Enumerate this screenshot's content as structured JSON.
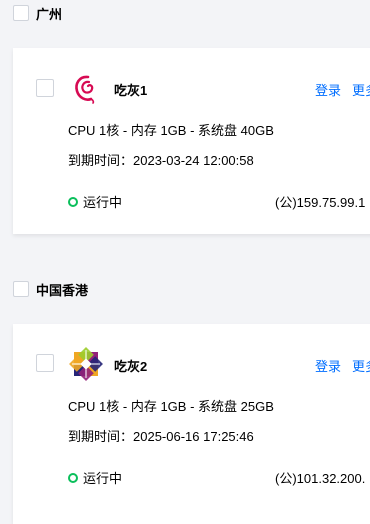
{
  "regions": [
    {
      "title": "广州",
      "instance": {
        "name": "吃灰1",
        "os_icon": "debian-icon",
        "login_label": "登录",
        "more_label": "更多",
        "spec": "CPU 1核 - 内存 1GB - 系统盘 40GB",
        "expire_label": "到期时间：",
        "expire_value": "2023-03-24 12:00:58",
        "status": "运行中",
        "ip": "(公)159.75.99.1"
      }
    },
    {
      "title": "中国香港",
      "instance": {
        "name": "吃灰2",
        "os_icon": "centos-icon",
        "login_label": "登录",
        "more_label": "更多",
        "spec": "CPU 1核 - 内存 1GB - 系统盘 25GB",
        "expire_label": "到期时间：",
        "expire_value": "2025-06-16 17:25:46",
        "status": "运行中",
        "ip": "(公)101.32.200."
      }
    }
  ],
  "colors": {
    "link": "#006eff",
    "status_running": "#0abf5b",
    "background": "#f3f4f7",
    "debian": "#d70a53"
  }
}
